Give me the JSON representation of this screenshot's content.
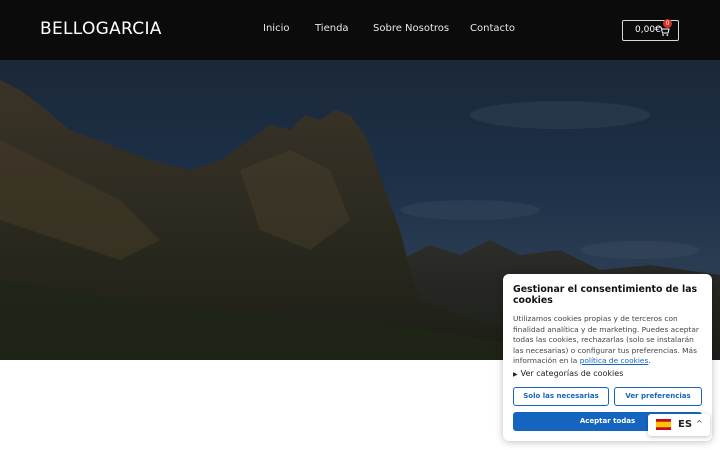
{
  "header": {
    "brand": "BELLOGARCIA",
    "nav": [
      {
        "label": "Inicio"
      },
      {
        "label": "Tienda"
      },
      {
        "label": "Sobre Nosotros"
      },
      {
        "label": "Contacto"
      }
    ],
    "cart": {
      "amount": "0,00€",
      "count": "0"
    }
  },
  "cookie_banner": {
    "title": "Gestionar el consentimiento de las cookies",
    "body": "Utilizamos cookies propias y de terceros con finalidad analítica y de marketing. Puedes aceptar todas las cookies, rechazarlas (solo se instalarán las necesarias) o configurar tus preferencias. Más información en la ",
    "policy_link": "política de cookies",
    "body_end": ".",
    "categories_toggle": "Ver categorías de cookies",
    "buttons": {
      "necessary": "Solo las necesarias",
      "preferences": "Ver preferencias",
      "accept_all": "Aceptar todas"
    }
  },
  "language": {
    "code": "ES",
    "flag": "spain-flag-icon"
  },
  "colors": {
    "accent": "#1565c0",
    "topbar": "#0b0b0b",
    "badge": "#d93025"
  }
}
